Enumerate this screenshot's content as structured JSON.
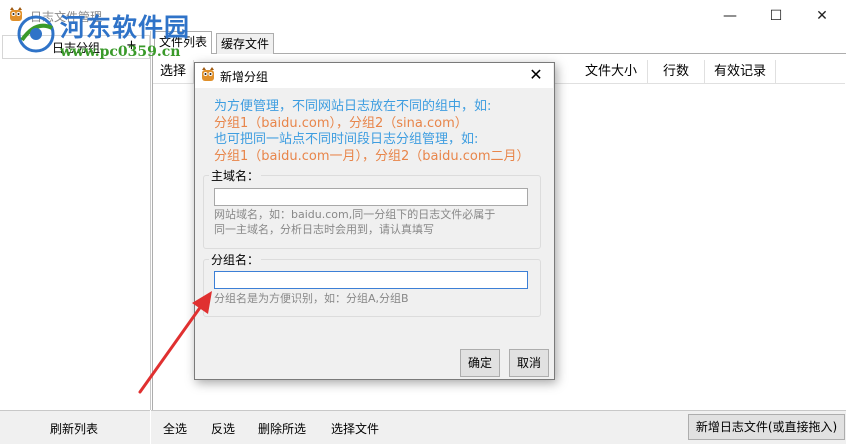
{
  "window": {
    "title": "日志文件管理",
    "min": "—",
    "max": "☐",
    "close": "✕"
  },
  "watermark": {
    "site": "河东软件园",
    "url": "www.pc0359.cn"
  },
  "left_panel": {
    "header": "日志分组",
    "add": "+",
    "refresh": "刷新列表"
  },
  "tabs": [
    {
      "label": "文件列表"
    },
    {
      "label": "缓存文件"
    }
  ],
  "columns": {
    "select": "选择",
    "size": "文件大小",
    "lines": "行数",
    "valid": "有效记录"
  },
  "bottom": {
    "select_all": "全选",
    "invert": "反选",
    "delete_selected": "删除所选",
    "choose_file": "选择文件",
    "add_log": "新增日志文件(或直接拖入)"
  },
  "dialog": {
    "title": "新增分组",
    "close": "✕",
    "hint1": "为方便管理，不同网站日志放在不同的组中，如:",
    "hint2": "分组1（baidu.com），分组2（sina.com）",
    "hint3": "也可把同一站点不同时间段日志分组管理，如:",
    "hint4": "分组1（baidu.com一月），分组2（baidu.com二月）",
    "domain_label": "主域名：",
    "domain_value": "",
    "domain_note1": "网站域名，如：baidu.com,同一分组下的日志文件必属于",
    "domain_note2": "同一主域名，分析日志时会用到，请认真填写",
    "group_label": "分组名：",
    "group_value": "",
    "group_note": "分组名是为方便识别，如：分组A,分组B",
    "ok": "确定",
    "cancel": "取消"
  },
  "colors": {
    "hint_blue": "#3d9de0",
    "hint_orange": "#e8854a",
    "arrow": "#e03030",
    "focus": "#3c7fd6"
  }
}
